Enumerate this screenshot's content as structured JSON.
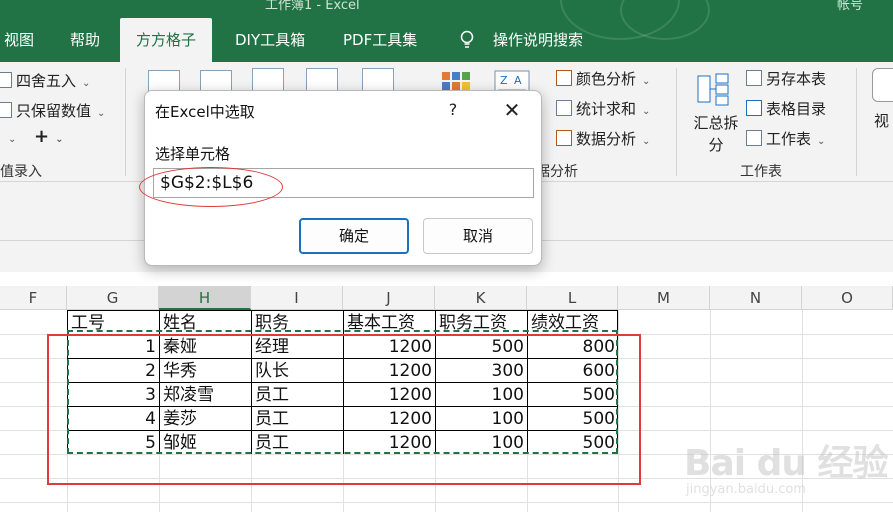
{
  "titlebar": {
    "title": "工作簿1 - Excel",
    "user": "帐号"
  },
  "menu": [
    {
      "label": "视图"
    },
    {
      "label": "帮助"
    },
    {
      "label": "方方格子"
    },
    {
      "label": "DIY工具箱"
    },
    {
      "label": "PDF工具集"
    },
    {
      "label": "操作说明搜索"
    }
  ],
  "ribbon": {
    "left": {
      "round": "四舍五入",
      "keep": "只保留数值",
      "plus": "+",
      "group": "值录入"
    },
    "analysis": {
      "color": "颜色分析",
      "stats": "统计求和",
      "data": "数据分析",
      "group": "据分析"
    },
    "sheet": {
      "split": "汇总拆分",
      "saveas": "另存本表",
      "toc": "表格目录",
      "ws": "工作表",
      "group": "工作表"
    },
    "view": "视"
  },
  "columns": [
    "F",
    "G",
    "H",
    "I",
    "J",
    "K",
    "L",
    "M",
    "N",
    "O"
  ],
  "table": {
    "headers": [
      "工号",
      "姓名",
      "职务",
      "基本工资",
      "职务工资",
      "绩效工资"
    ],
    "rows": [
      [
        "1",
        "秦娅",
        "经理",
        "1200",
        "500",
        "800"
      ],
      [
        "2",
        "华秀",
        "队长",
        "1200",
        "300",
        "600"
      ],
      [
        "3",
        "郑凌雪",
        "员工",
        "1200",
        "100",
        "500"
      ],
      [
        "4",
        "姜莎",
        "员工",
        "1200",
        "100",
        "500"
      ],
      [
        "5",
        "邹姬",
        "员工",
        "1200",
        "100",
        "500"
      ]
    ]
  },
  "dialog": {
    "title": "在Excel中选取",
    "help": "?",
    "close": "✕",
    "label": "选择单元格",
    "value": "$G$2:$L$6",
    "ok": "确定",
    "cancel": "取消"
  },
  "watermark": {
    "brand": "Bai du 经验",
    "url": "jingyan.baidu.com"
  },
  "colors": {
    "excel_green": "#217346",
    "highlight_red": "#e03a3a",
    "focus_blue": "#1f6fbf"
  }
}
